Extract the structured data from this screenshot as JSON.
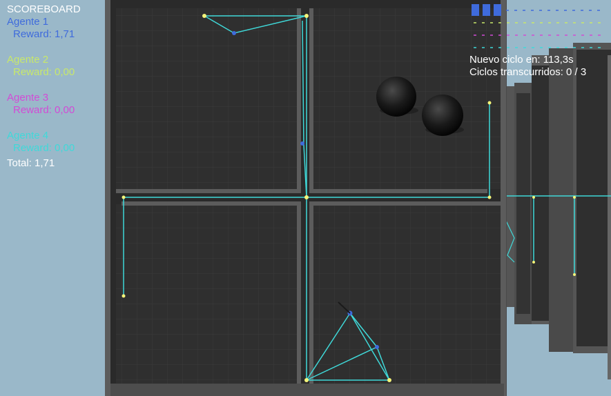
{
  "scoreboard": {
    "title": "SCOREBOARD",
    "agents": [
      {
        "name": "Agente 1",
        "reward": "Reward: 1,71",
        "color": "#3f6bdc"
      },
      {
        "name": "Agente 2",
        "reward": "Reward: 0,00",
        "color": "#c8e86a"
      },
      {
        "name": "Agente 3",
        "reward": "Reward: 0,00",
        "color": "#d24bd6"
      },
      {
        "name": "Agente 4",
        "reward": "Reward: 0,00",
        "color": "#3fd9d9"
      }
    ],
    "total": "Total: 1,71"
  },
  "status": {
    "next_cycle": "Nuevo ciclo en: 113,3s",
    "cycles": "Ciclos transcurridos: 0 / 3"
  },
  "colors": {
    "sky": "#9ab8c9",
    "floor": "#2f2f2f",
    "wall": "#5a5a5a",
    "path": "#3fd9d9",
    "node": "#f4f47a",
    "agent": "#3f6bdc"
  }
}
